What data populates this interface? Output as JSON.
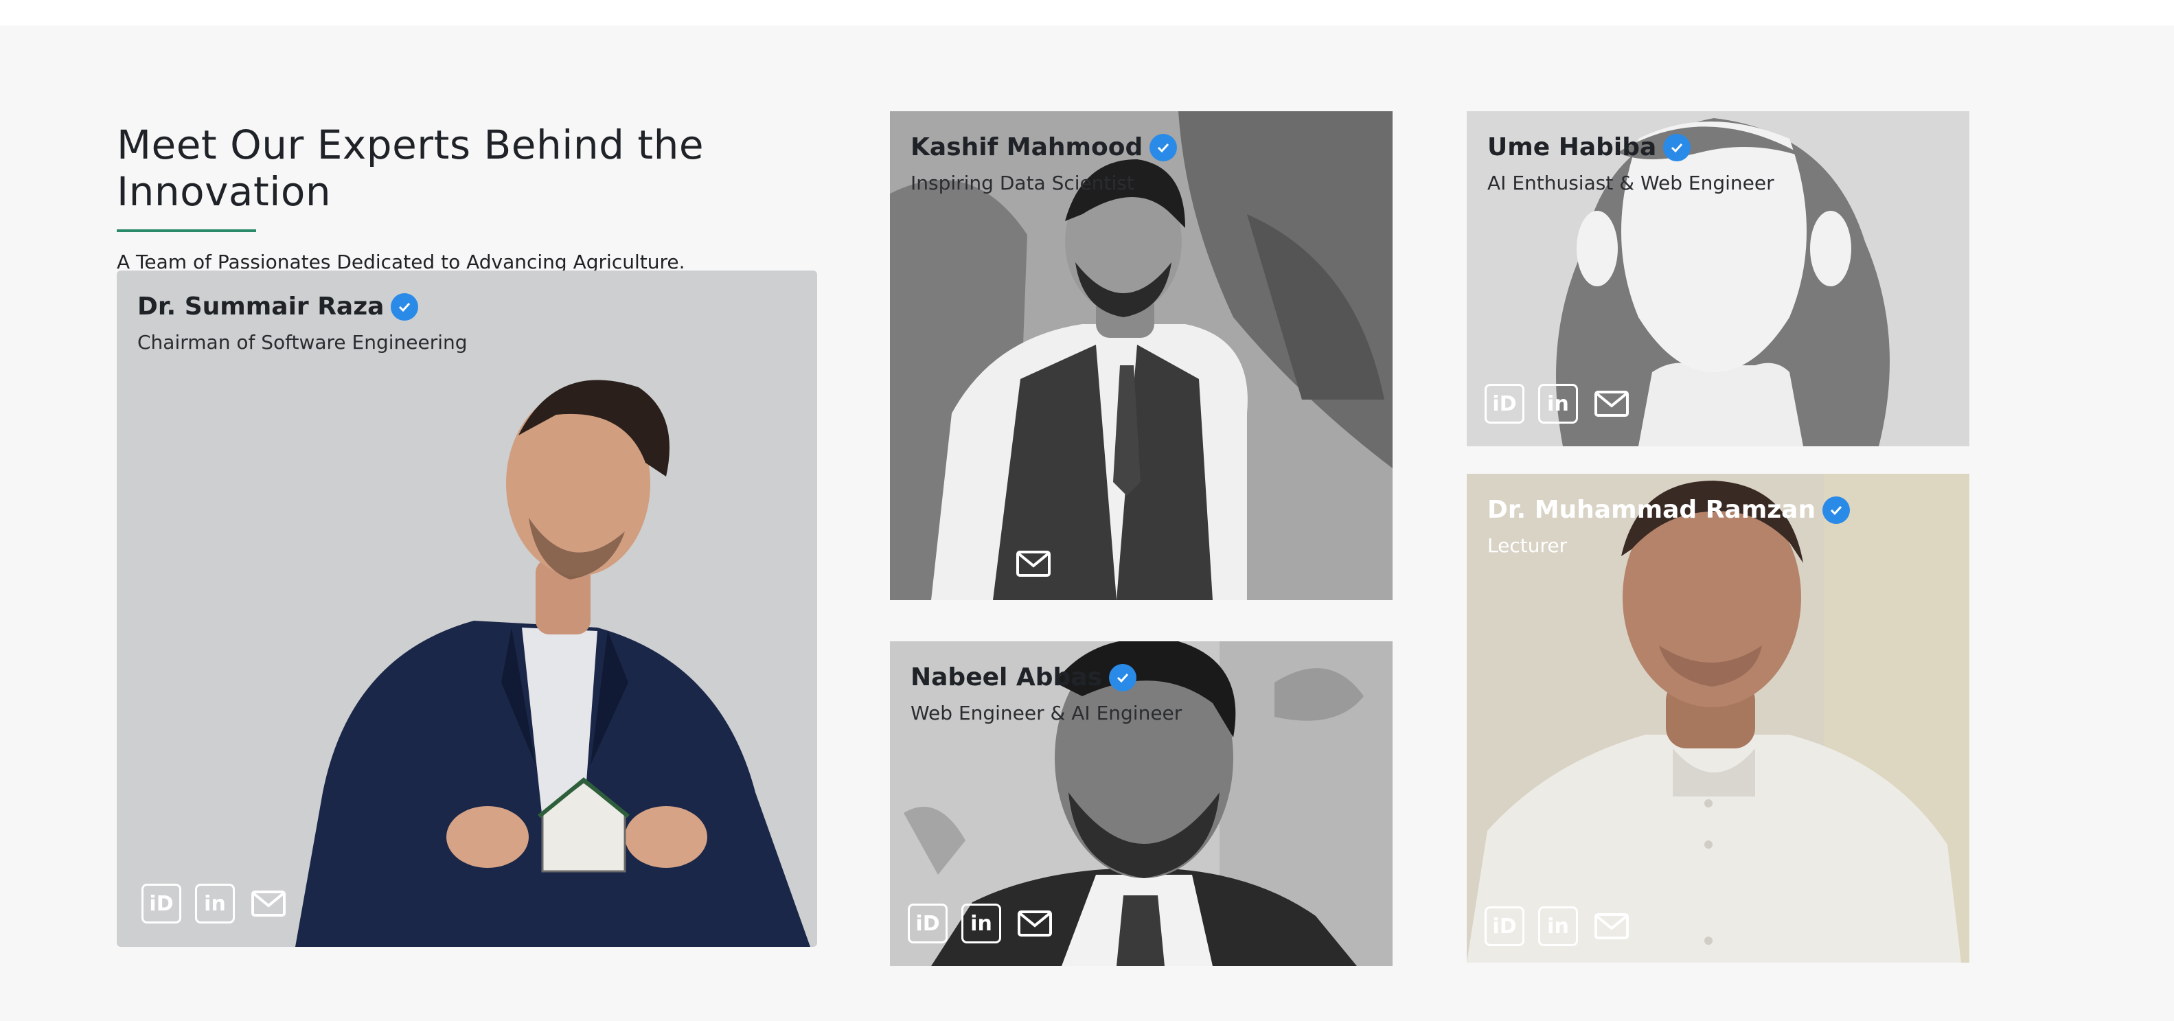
{
  "section": {
    "title": "Meet Our Experts Behind the Innovation",
    "subtitle": "A Team of Passionates Dedicated to Advancing Agriculture."
  },
  "members": [
    {
      "name": "Dr. Summair Raza",
      "role": "Chairman of Software Engineering",
      "links": [
        "orcid-icon",
        "linkedin-icon",
        "mail-icon"
      ]
    },
    {
      "name": "Kashif Mahmood",
      "role": "Inspiring Data Scientist",
      "links": [
        "mail-icon"
      ]
    },
    {
      "name": "Nabeel Abbas",
      "role": "Web Engineer & AI Engineer",
      "links": [
        "orcid-icon",
        "linkedin-icon",
        "mail-icon"
      ]
    },
    {
      "name": "Ume Habiba",
      "role": "AI Enthusiast & Web Engineer",
      "links": [
        "orcid-icon",
        "linkedin-icon",
        "mail-icon"
      ]
    },
    {
      "name": "Dr. Muhammad Ramzan",
      "role": "Lecturer",
      "links": [
        "orcid-icon",
        "linkedin-icon",
        "mail-icon"
      ]
    }
  ],
  "icons": {
    "orcid_text": "iD",
    "linkedin_text": "in"
  },
  "colors": {
    "accent": "#2b8a6a",
    "verified": "#2a8ae8",
    "background": "#f8f7f8"
  }
}
